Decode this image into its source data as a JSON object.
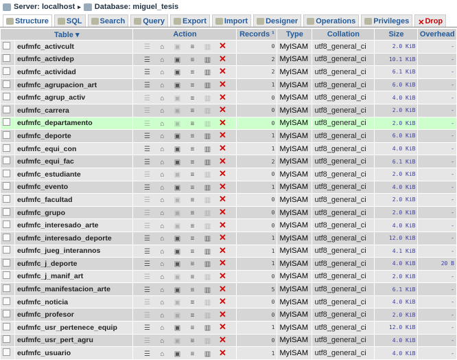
{
  "breadcrumb": {
    "server": "Server: localhost",
    "database": "Database: miguel_tesis"
  },
  "tabs": [
    "Structure",
    "SQL",
    "Search",
    "Query",
    "Export",
    "Import",
    "Designer",
    "Operations",
    "Privileges",
    "Drop"
  ],
  "headers": {
    "table": "Table ▾",
    "action": "Action",
    "records": "Records ¹",
    "type": "Type",
    "collation": "Collation",
    "size": "Size",
    "overhead": "Overhead"
  },
  "highlight_row": "eufmfc_departamento",
  "rows": [
    [
      "eufmfc_activcult",
      "0",
      "MyISAM",
      "utf8_general_ci",
      "2.0 KiB",
      "-"
    ],
    [
      "eufmfc_activdep",
      "2",
      "MyISAM",
      "utf8_general_ci",
      "10.1 KiB",
      "-"
    ],
    [
      "eufmfc_actividad",
      "2",
      "MyISAM",
      "utf8_general_ci",
      "6.1 KiB",
      "-"
    ],
    [
      "eufmfc_agrupacion_art",
      "1",
      "MyISAM",
      "utf8_general_ci",
      "6.0 KiB",
      "-"
    ],
    [
      "eufmfc_agrup_activ",
      "0",
      "MyISAM",
      "utf8_general_ci",
      "4.0 KiB",
      "-"
    ],
    [
      "eufmfc_carrera",
      "0",
      "MyISAM",
      "utf8_general_ci",
      "2.0 KiB",
      "-"
    ],
    [
      "eufmfc_departamento",
      "0",
      "MyISAM",
      "utf8_general_ci",
      "2.0 KiB",
      "-"
    ],
    [
      "eufmfc_deporte",
      "1",
      "MyISAM",
      "utf8_general_ci",
      "6.0 KiB",
      "-"
    ],
    [
      "eufmfc_equi_con",
      "1",
      "MyISAM",
      "utf8_general_ci",
      "4.0 KiB",
      "-"
    ],
    [
      "eufmfc_equi_fac",
      "2",
      "MyISAM",
      "utf8_general_ci",
      "6.1 KiB",
      "-"
    ],
    [
      "eufmfc_estudiante",
      "0",
      "MyISAM",
      "utf8_general_ci",
      "2.0 KiB",
      "-"
    ],
    [
      "eufmfc_evento",
      "1",
      "MyISAM",
      "utf8_general_ci",
      "4.0 KiB",
      "-"
    ],
    [
      "eufmfc_facultad",
      "0",
      "MyISAM",
      "utf8_general_ci",
      "2.0 KiB",
      "-"
    ],
    [
      "eufmfc_grupo",
      "0",
      "MyISAM",
      "utf8_general_ci",
      "2.0 KiB",
      "-"
    ],
    [
      "eufmfc_interesado_arte",
      "0",
      "MyISAM",
      "utf8_general_ci",
      "4.0 KiB",
      "-"
    ],
    [
      "eufmfc_interesado_deporte",
      "1",
      "MyISAM",
      "utf8_general_ci",
      "12.0 KiB",
      "-"
    ],
    [
      "eufmfc_jueg_interannos",
      "1",
      "MyISAM",
      "utf8_general_ci",
      "4.1 KiB",
      "-"
    ],
    [
      "eufmfc_j_deporte",
      "1",
      "MyISAM",
      "utf8_general_ci",
      "4.0 KiB",
      "20 B"
    ],
    [
      "eufmfc_j_manif_art",
      "0",
      "MyISAM",
      "utf8_general_ci",
      "2.0 KiB",
      "-"
    ],
    [
      "eufmfc_manifestacion_arte",
      "5",
      "MyISAM",
      "utf8_general_ci",
      "6.1 KiB",
      "-"
    ],
    [
      "eufmfc_noticia",
      "0",
      "MyISAM",
      "utf8_general_ci",
      "4.0 KiB",
      "-"
    ],
    [
      "eufmfc_profesor",
      "0",
      "MyISAM",
      "utf8_general_ci",
      "2.0 KiB",
      "-"
    ],
    [
      "eufmfc_usr_pertenece_equip",
      "1",
      "MyISAM",
      "utf8_general_ci",
      "12.0 KiB",
      "-"
    ],
    [
      "eufmfc_usr_pert_agru",
      "0",
      "MyISAM",
      "utf8_general_ci",
      "4.0 KiB",
      "-"
    ],
    [
      "eufmfc_usuario",
      "1",
      "MyISAM",
      "utf8_general_ci",
      "4.0 KiB",
      "-"
    ]
  ]
}
